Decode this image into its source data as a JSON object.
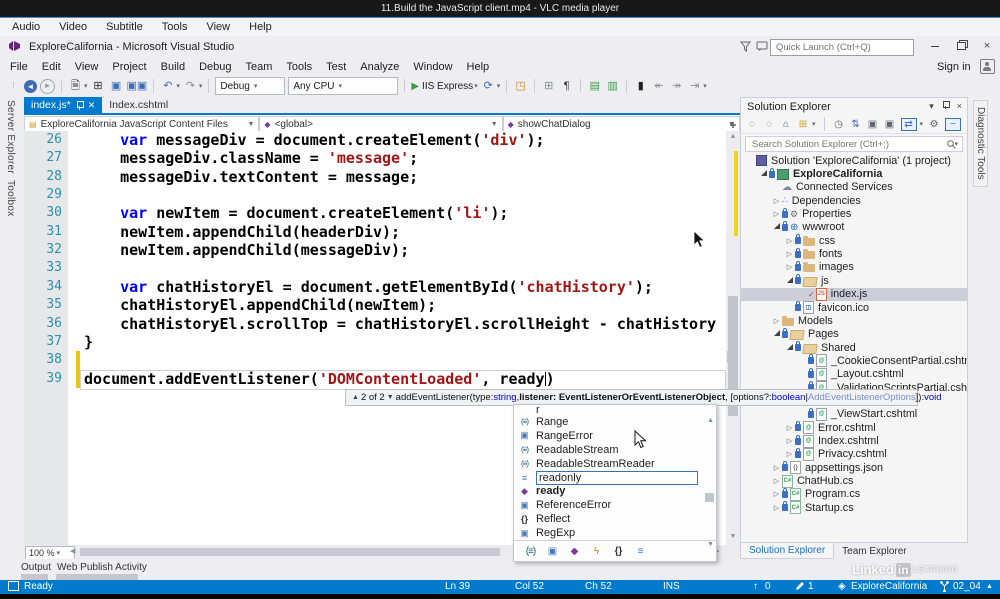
{
  "colors": {
    "accent": "#007acc",
    "keyword": "#0000ff",
    "string": "#a31515",
    "line_number": "#2b91af",
    "change_bar": "#eac21a",
    "selection": "#ccceda"
  },
  "vlc": {
    "title": "11.Build the JavaScript client.mp4 - VLC media player",
    "menu": [
      "Audio",
      "Video",
      "Subtitle",
      "Tools",
      "View",
      "Help"
    ]
  },
  "vs": {
    "title": "ExploreCalifornia - Microsoft Visual Studio",
    "quick_launch_placeholder": "Quick Launch (Ctrl+Q)",
    "menu": [
      "File",
      "Edit",
      "View",
      "Project",
      "Build",
      "Debug",
      "Team",
      "Tools",
      "Test",
      "Analyze",
      "Window",
      "Help"
    ],
    "sign_in": "Sign in",
    "toolbar": {
      "debug": "Debug",
      "platform": "Any CPU",
      "run": "IIS Express"
    },
    "left_tabs": [
      "Server Explorer",
      "Toolbox"
    ],
    "right_tab": "Diagnostic Tools"
  },
  "editor": {
    "tabs": [
      {
        "label": "index.js*",
        "active": true
      },
      {
        "label": "Index.cshtml",
        "active": false
      }
    ],
    "breadcrumbs": [
      "ExploreCalifornia JavaScript Content Files",
      "<global>",
      "showChatDialog"
    ],
    "zoom": "100 %",
    "lines": [
      {
        "n": 26,
        "segs": [
          {
            "t": "    ",
            "c": "pl"
          },
          {
            "t": "var",
            "c": "kw"
          },
          {
            "t": " messageDiv = document.createElement(",
            "c": "pl"
          },
          {
            "t": "'div'",
            "c": "str"
          },
          {
            "t": ");",
            "c": "pl"
          }
        ]
      },
      {
        "n": 27,
        "segs": [
          {
            "t": "    messageDiv.className = ",
            "c": "pl"
          },
          {
            "t": "'message'",
            "c": "str"
          },
          {
            "t": ";",
            "c": "pl"
          }
        ]
      },
      {
        "n": 28,
        "segs": [
          {
            "t": "    messageDiv.textContent = message;",
            "c": "pl"
          }
        ]
      },
      {
        "n": 29,
        "segs": []
      },
      {
        "n": 30,
        "segs": [
          {
            "t": "    ",
            "c": "pl"
          },
          {
            "t": "var",
            "c": "kw"
          },
          {
            "t": " newItem = document.createElement(",
            "c": "pl"
          },
          {
            "t": "'li'",
            "c": "str"
          },
          {
            "t": ");",
            "c": "pl"
          }
        ]
      },
      {
        "n": 31,
        "segs": [
          {
            "t": "    newItem.appendChild(headerDiv);",
            "c": "pl"
          }
        ]
      },
      {
        "n": 32,
        "segs": [
          {
            "t": "    newItem.appendChild(messageDiv);",
            "c": "pl"
          }
        ]
      },
      {
        "n": 33,
        "segs": []
      },
      {
        "n": 34,
        "segs": [
          {
            "t": "    ",
            "c": "pl"
          },
          {
            "t": "var",
            "c": "kw"
          },
          {
            "t": " chatHistoryEl = document.getElementById(",
            "c": "pl"
          },
          {
            "t": "'chatHistory'",
            "c": "str"
          },
          {
            "t": ");",
            "c": "pl"
          }
        ]
      },
      {
        "n": 35,
        "segs": [
          {
            "t": "    chatHistoryEl.appendChild(newItem);",
            "c": "pl"
          }
        ]
      },
      {
        "n": 36,
        "segs": [
          {
            "t": "    chatHistoryEl.scrollTop = chatHistoryEl.scrollHeight - chatHistory",
            "c": "pl"
          }
        ]
      },
      {
        "n": 37,
        "segs": [
          {
            "t": "}",
            "c": "pl"
          }
        ]
      },
      {
        "n": 38,
        "changed": true,
        "segs": []
      },
      {
        "n": 39,
        "changed": true,
        "current": true,
        "segs": [
          {
            "t": "document.addEventListener(",
            "c": "pl"
          },
          {
            "t": "'DOMContentLoaded'",
            "c": "str"
          },
          {
            "t": ", ready",
            "c": "pl"
          },
          {
            "t": "",
            "c": "caret"
          },
          {
            "t": ")",
            "c": "pl"
          }
        ]
      }
    ]
  },
  "signature_help": {
    "segs": [
      {
        "t": "▲",
        "c": "arrow"
      },
      {
        "t": "2 of 2",
        "c": "pl"
      },
      {
        "t": "▼",
        "c": "arrow"
      },
      {
        "t": " addEventListener(type: ",
        "c": "pl"
      },
      {
        "t": "string",
        "c": "blue"
      },
      {
        "t": ", ",
        "c": "pl"
      },
      {
        "t": "listener: EventListenerOrEventListenerObject",
        "c": "bold"
      },
      {
        "t": ", [options?: ",
        "c": "pl"
      },
      {
        "t": "boolean",
        "c": "blue"
      },
      {
        "t": " | ",
        "c": "pl"
      },
      {
        "t": "AddEventListenerOptions",
        "c": "lblue"
      },
      {
        "t": "]): ",
        "c": "pl"
      },
      {
        "t": "void",
        "c": "blue"
      }
    ]
  },
  "intellisense": {
    "items": [
      {
        "label": "r",
        "icon": "none",
        "partial": true
      },
      {
        "label": "Range",
        "icon": "interface"
      },
      {
        "label": "RangeError",
        "icon": "class"
      },
      {
        "label": "ReadableStream",
        "icon": "interface"
      },
      {
        "label": "ReadableStreamReader",
        "icon": "interface"
      },
      {
        "label": "readonly",
        "icon": "keyword",
        "selected": true
      },
      {
        "label": "ready",
        "icon": "method",
        "bold": true
      },
      {
        "label": "ReferenceError",
        "icon": "class"
      },
      {
        "label": "Reflect",
        "icon": "namespace"
      },
      {
        "label": "RegExp",
        "icon": "class"
      }
    ],
    "filters": [
      "interface",
      "class",
      "method",
      "event",
      "namespace",
      "keyword"
    ]
  },
  "solution_explorer": {
    "title": "Solution Explorer",
    "search_placeholder": "Search Solution Explorer (Ctrl+;)",
    "tree": [
      {
        "label": "Solution 'ExploreCalifornia' (1 project)",
        "depth": 0,
        "icon": "sol",
        "exp": "none"
      },
      {
        "label": "ExploreCalifornia",
        "depth": 1,
        "icon": "proj",
        "exp": "open",
        "bold": true,
        "lock": true
      },
      {
        "label": "Connected Services",
        "depth": 2,
        "icon": "cloud",
        "exp": "none"
      },
      {
        "label": "Dependencies",
        "depth": 2,
        "icon": "dep",
        "exp": "closed"
      },
      {
        "label": "Properties",
        "depth": 2,
        "icon": "wrench",
        "exp": "closed",
        "lock": true
      },
      {
        "label": "wwwroot",
        "depth": 2,
        "icon": "globe",
        "exp": "open",
        "lock": true
      },
      {
        "label": "css",
        "depth": 3,
        "icon": "folder",
        "exp": "closed",
        "lock": true
      },
      {
        "label": "fonts",
        "depth": 3,
        "icon": "folder",
        "exp": "closed",
        "lock": true
      },
      {
        "label": "images",
        "depth": 3,
        "icon": "folder",
        "exp": "closed",
        "lock": true
      },
      {
        "label": "js",
        "depth": 3,
        "icon": "folder-open",
        "exp": "open",
        "lock": true
      },
      {
        "label": "index.js",
        "depth": 4,
        "icon": "js",
        "exp": "none",
        "check": true,
        "selected": true
      },
      {
        "label": "favicon.ico",
        "depth": 3,
        "icon": "ico",
        "exp": "none",
        "lock": true
      },
      {
        "label": "Models",
        "depth": 2,
        "icon": "folder",
        "exp": "closed"
      },
      {
        "label": "Pages",
        "depth": 2,
        "icon": "folder-open",
        "exp": "open",
        "lock": true
      },
      {
        "label": "Shared",
        "depth": 3,
        "icon": "folder-open",
        "exp": "open",
        "lock": true
      },
      {
        "label": "_CookieConsentPartial.cshtml",
        "depth": 4,
        "icon": "razor",
        "exp": "none",
        "lock": true
      },
      {
        "label": "_Layout.cshtml",
        "depth": 4,
        "icon": "razor",
        "exp": "none",
        "lock": true
      },
      {
        "label": "_ValidationScriptsPartial.cshtml",
        "depth": 4,
        "icon": "razor",
        "exp": "none",
        "lock": true
      },
      {
        "label": "",
        "depth": 4,
        "icon": "none",
        "exp": "none",
        "hidden": true
      },
      {
        "label": "_ViewStart.cshtml",
        "depth": 4,
        "icon": "razor",
        "exp": "none",
        "lock": true
      },
      {
        "label": "Error.cshtml",
        "depth": 3,
        "icon": "razor",
        "exp": "closed",
        "lock": true
      },
      {
        "label": "Index.cshtml",
        "depth": 3,
        "icon": "razor",
        "exp": "closed",
        "lock": true
      },
      {
        "label": "Privacy.cshtml",
        "depth": 3,
        "icon": "razor",
        "exp": "closed",
        "lock": true
      },
      {
        "label": "appsettings.json",
        "depth": 2,
        "icon": "json",
        "exp": "closed",
        "lock": true
      },
      {
        "label": "ChatHub.cs",
        "depth": 2,
        "icon": "cs",
        "exp": "closed"
      },
      {
        "label": "Program.cs",
        "depth": 2,
        "icon": "cs",
        "exp": "closed",
        "lock": true
      },
      {
        "label": "Startup.cs",
        "depth": 2,
        "icon": "cs",
        "exp": "closed",
        "lock": true
      }
    ],
    "bottom_tabs": [
      "Solution Explorer",
      "Team Explorer"
    ]
  },
  "output": {
    "tabs": [
      "Output",
      "Web Publish Activity"
    ]
  },
  "status_bar": {
    "ready": "Ready",
    "ln": "Ln 39",
    "col": "Col 52",
    "ch": "Ch 52",
    "ins": "INS",
    "pushes": "0",
    "edits": "1",
    "project": "ExploreCalifornia",
    "branch": "02_04"
  },
  "watermark": {
    "p1": "Linked",
    "p2": "in",
    "p3": "LEARNING"
  }
}
